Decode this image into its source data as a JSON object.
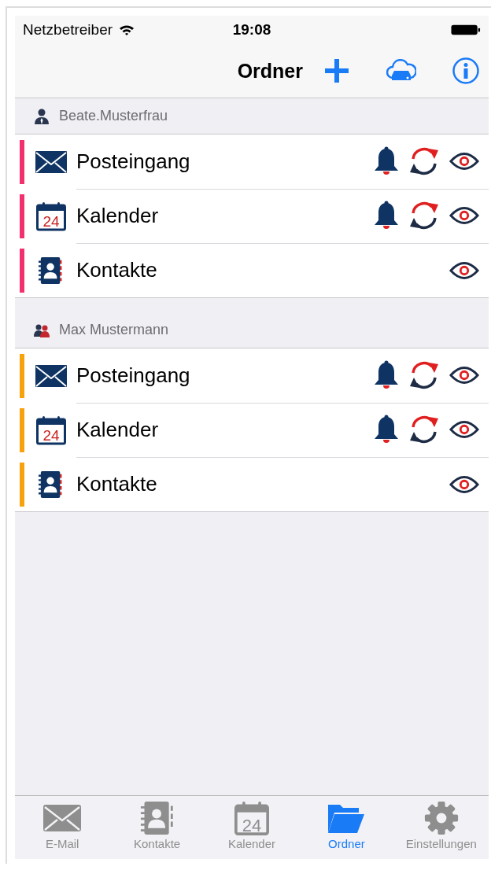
{
  "status_bar": {
    "carrier": "Netzbetreiber",
    "time": "19:08"
  },
  "nav_bar": {
    "title": "Ordner"
  },
  "accounts": [
    {
      "name": "Beate.Musterfrau",
      "kind": "single",
      "color": "#f3306e",
      "folders": [
        {
          "kind": "mail",
          "label": "Posteingang",
          "notify": true,
          "sync": true,
          "visible": true
        },
        {
          "kind": "calendar",
          "label": "Kalender",
          "day": "24",
          "notify": true,
          "sync": true,
          "visible": true
        },
        {
          "kind": "contacts",
          "label": "Kontakte",
          "notify": false,
          "sync": false,
          "visible": true
        }
      ]
    },
    {
      "name": "Max Mustermann",
      "kind": "group",
      "color": "#f7a20d",
      "folders": [
        {
          "kind": "mail",
          "label": "Posteingang",
          "notify": true,
          "sync": true,
          "visible": true
        },
        {
          "kind": "calendar",
          "label": "Kalender",
          "day": "24",
          "notify": true,
          "sync": true,
          "visible": true
        },
        {
          "kind": "contacts",
          "label": "Kontakte",
          "notify": false,
          "sync": false,
          "visible": true
        }
      ]
    }
  ],
  "tab_bar": [
    {
      "kind": "mail",
      "label": "E-Mail",
      "selected": false
    },
    {
      "kind": "contacts",
      "label": "Kontakte",
      "selected": false
    },
    {
      "kind": "calendar",
      "label": "Kalender",
      "day": "24",
      "selected": false
    },
    {
      "kind": "folder",
      "label": "Ordner",
      "selected": true
    },
    {
      "kind": "settings",
      "label": "Einstellungen",
      "selected": false
    }
  ]
}
